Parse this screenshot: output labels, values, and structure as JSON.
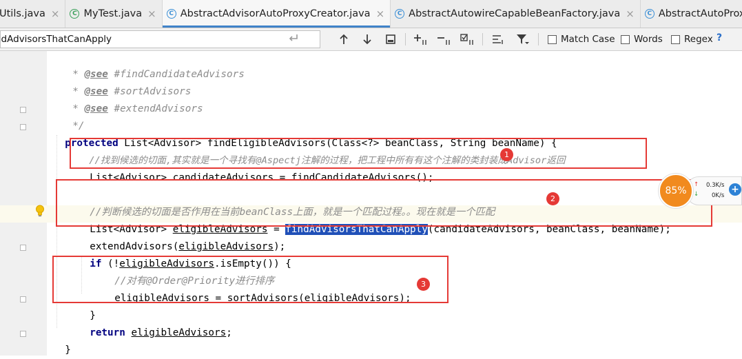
{
  "tabs": [
    {
      "label": "Utils.java",
      "icon": "none",
      "active": false
    },
    {
      "label": "MyTest.java",
      "icon": "test-class-icon",
      "active": false
    },
    {
      "label": "AbstractAdvisorAutoProxyCreator.java",
      "icon": "class-icon",
      "active": true
    },
    {
      "label": "AbstractAutowireCapableBeanFactory.java",
      "icon": "class-icon",
      "active": false
    },
    {
      "label": "AbstractAutoProxyCreato",
      "icon": "class-icon",
      "active": false
    }
  ],
  "close_glyph": "×",
  "class_glyph": "C",
  "search": {
    "value": "ndAdvisorsThatCanApply",
    "match_case_label": "Match Case",
    "words_label": "Words",
    "regex_label": "Regex",
    "help_label": "?"
  },
  "code": {
    "see1_tag": "@see",
    "see1_ref": "#findCandidateAdvisors",
    "see2_tag": "@see",
    "see2_ref": "#sortAdvisors",
    "see3_tag": "@see",
    "see3_ref": "#extendAdvisors",
    "javadoc_end": "*/",
    "star": "*",
    "kw_protected": "protected",
    "sig_rest": "List<Advisor> findEligibleAdvisors(Class<?> beanClass, String beanName) {",
    "comment1": "//找到候选的切面,其实就是一个寻找有@Aspectj注解的过程，把工程中所有有这个注解的类封装成Advisor返回",
    "line_candidate": "List<Advisor> candidateAdvisors = findCandidateAdvisors();",
    "comment2": "//判断候选的切面是否作用在当前beanClass上面，就是一个匹配过程。。现在就是一个匹配",
    "eligible_decl_a": "List<Advisor> ",
    "eligible_var": "eligibleAdvisors",
    "eligible_decl_b": " = ",
    "eligible_call": "findAdvisorsThatCanApply",
    "eligible_decl_c": "(candidateAdvisors, beanClass, beanName);",
    "extend_a": "extendAdvisors(",
    "extend_var": "eligibleAdvisors",
    "extend_b": ");",
    "kw_if": "if",
    "if_a": " (!",
    "if_var": "eligibleAdvisors",
    "if_b": ".isEmpty()) {",
    "comment3": "//对有@Order@Priority进行排序",
    "sort_var": "eligibleAdvisors",
    "sort_a": " = sortAdvisors(",
    "sort_var2": "eligibleAdvisors",
    "sort_b": ");",
    "close_if": "}",
    "kw_return": "return",
    "return_var": "eligibleAdvisors",
    "return_b": ";",
    "close_method": "}"
  },
  "annotations": [
    "1",
    "2",
    "3"
  ],
  "widget": {
    "percent": "85%",
    "upload": "0.3K/s",
    "download": "0K/s",
    "plus_label": "+"
  },
  "colors": {
    "keyword": "#000080",
    "comment": "#8c8c8c",
    "selection": "#2050b8",
    "annotation": "#e53935",
    "gauge": "#f18a1e"
  }
}
